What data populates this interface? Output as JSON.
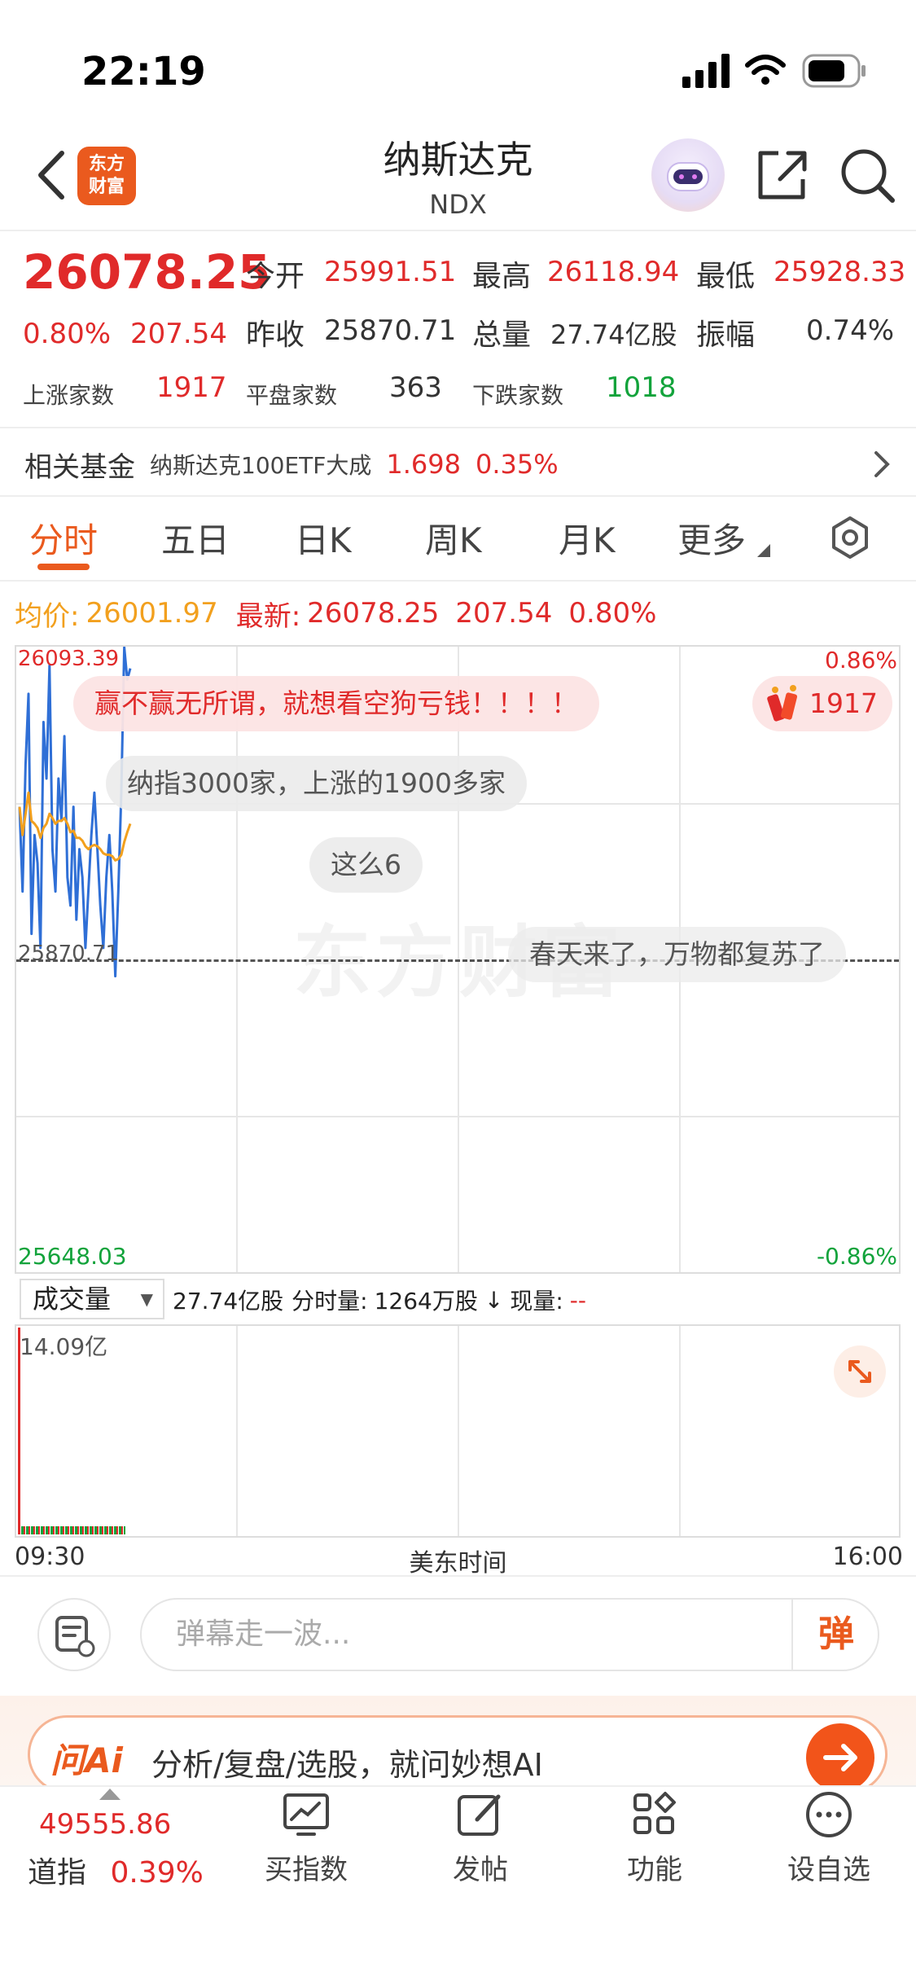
{
  "status_bar": {
    "time": "22:19"
  },
  "header": {
    "logo_line1": "东方",
    "logo_line2": "财富",
    "title": "纳斯达克",
    "subtitle": "NDX"
  },
  "quote": {
    "price": "26078.25",
    "change_pct": "0.80%",
    "change_amt": "207.54",
    "open_label": "今开",
    "open": "25991.51",
    "high_label": "最高",
    "high": "26118.94",
    "low_label": "最低",
    "low": "25928.33",
    "prev_close_label": "昨收",
    "prev_close": "25870.71",
    "volume_label": "总量",
    "volume": "27.74亿股",
    "amplitude_label": "振幅",
    "amplitude": "0.74%",
    "up_label": "上涨家数",
    "up": "1917",
    "flat_label": "平盘家数",
    "flat": "363",
    "down_label": "下跌家数",
    "down": "1018"
  },
  "related_fund": {
    "label": "相关基金",
    "name": "纳斯达克100ETF大成",
    "price": "1.698",
    "change": "0.35%"
  },
  "tabs": [
    "分时",
    "五日",
    "日K",
    "周K",
    "月K",
    "更多"
  ],
  "summary": {
    "avg_label": "均价:",
    "avg": "26001.97",
    "latest_label": "最新:",
    "latest": "26078.25",
    "change_amt": "207.54",
    "change_pct": "0.80%"
  },
  "chart": {
    "top_price": "26093.39",
    "top_pct": "0.86%",
    "mid_price": "25870.71",
    "bottom_price": "25648.03",
    "bottom_pct": "-0.86%",
    "watermark": "东方财富",
    "up_badge": "1917",
    "comments": [
      "赢不赢无所谓，就想看空狗亏钱！！！！",
      "纳指3000家，上涨的1900多家",
      "这么6",
      "春天来了，万物都复苏了"
    ]
  },
  "chart_data": {
    "type": "line",
    "ylim": [
      25648.03,
      26093.39
    ],
    "reference": 25870.71,
    "series": [
      {
        "name": "",
        "color": "#2f6fd6",
        "values": [
          25980,
          25920,
          26010,
          26060,
          25890,
          25960,
          25940,
          25880,
          26040,
          26000,
          26080,
          25950,
          25920,
          26000,
          25970,
          26030,
          25930,
          25910,
          25980,
          25900,
          25950,
          25930,
          25880,
          25920,
          25960,
          25990,
          25950,
          25910,
          25880,
          25930,
          25960,
          25920,
          25860,
          25920,
          25990,
          26093,
          26070,
          26078
        ]
      },
      {
        "name": "",
        "color": "#f2a01e",
        "values": [
          25980,
          25960,
          25975,
          25990,
          25970,
          25968,
          25965,
          25958,
          25965,
          25968,
          25975,
          25972,
          25968,
          25970,
          25970,
          25972,
          25968,
          25962,
          25963,
          25958,
          25958,
          25956,
          25952,
          25950,
          25952,
          25953,
          25952,
          25950,
          25947,
          25946,
          25946,
          25945,
          25942,
          25943,
          25946,
          25955,
          25962,
          25968
        ]
      }
    ]
  },
  "volume": {
    "select_label": "成交量",
    "total": "27.74亿股",
    "interval_label": "分时量:",
    "interval": "1264万股",
    "current_label": "现量:",
    "current": "--",
    "max_label": "14.09亿",
    "start_time": "09:30",
    "mid_label": "美东时间",
    "end_time": "16:00"
  },
  "danmaku": {
    "placeholder": "弹幕走一波...",
    "send_label": "弹"
  },
  "ai_banner": {
    "logo": "问Ai",
    "text": "分析/复盘/选股，就问妙想AI"
  },
  "bottom_nav": {
    "index_value": "49555.86",
    "index_name": "道指",
    "index_change": "0.39%",
    "items": [
      "买指数",
      "发帖",
      "功能",
      "设自选"
    ]
  }
}
